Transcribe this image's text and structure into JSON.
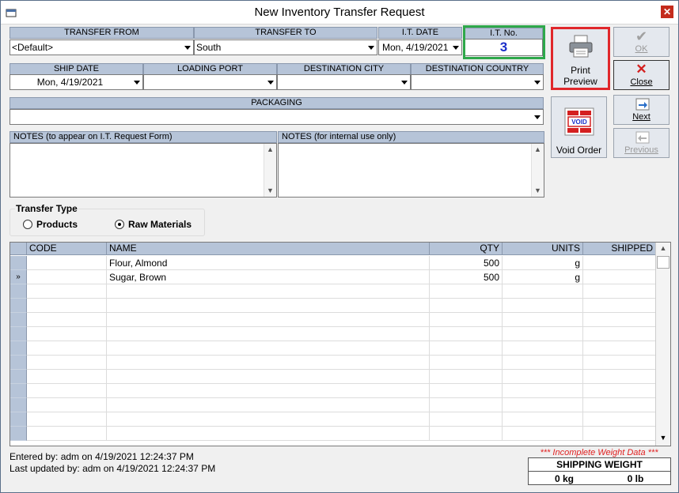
{
  "window": {
    "title": "New Inventory Transfer Request"
  },
  "row1": {
    "transfer_from": {
      "label": "TRANSFER FROM",
      "value": "<Default>"
    },
    "transfer_to": {
      "label": "TRANSFER TO",
      "value": "South"
    },
    "it_date": {
      "label": "I.T. DATE",
      "value": "Mon, 4/19/2021"
    },
    "it_no": {
      "label": "I.T. No.",
      "value": "3"
    }
  },
  "row2": {
    "ship_date": {
      "label": "SHIP DATE",
      "value": "Mon, 4/19/2021"
    },
    "loading_port": {
      "label": "LOADING PORT",
      "value": ""
    },
    "destination_city": {
      "label": "DESTINATION CITY",
      "value": ""
    },
    "destination_country": {
      "label": "DESTINATION COUNTRY",
      "value": ""
    }
  },
  "packaging": {
    "label": "PACKAGING",
    "value": ""
  },
  "notes": {
    "form_label": "NOTES (to appear on I.T. Request Form)",
    "internal_label": "NOTES (for internal use only)"
  },
  "buttons": {
    "print_preview_line1": "Print",
    "print_preview_line2": "Preview",
    "void_order": "Void Order",
    "void_stamp": "VOID",
    "ok": "OK",
    "close": "Close",
    "next": "Next",
    "previous": "Previous"
  },
  "transfer_type": {
    "title": "Transfer Type",
    "options": [
      "Products",
      "Raw Materials"
    ],
    "selected": "Raw Materials"
  },
  "grid": {
    "columns": [
      "CODE",
      "NAME",
      "QTY",
      "UNITS",
      "SHIPPED"
    ],
    "rows": [
      {
        "code": "",
        "name": "Flour, Almond",
        "qty": "500",
        "units": "g",
        "shipped": ""
      },
      {
        "code": "",
        "name": "Sugar, Brown",
        "qty": "500",
        "units": "g",
        "shipped": ""
      }
    ],
    "current_row_marker": "»"
  },
  "footer": {
    "entered_by": "Entered by: adm on 4/19/2021 12:24:37 PM",
    "last_updated": "Last updated by: adm on 4/19/2021 12:24:37 PM",
    "incomplete_warning": "*** Incomplete Weight Data ***",
    "shipping_weight_label": "SHIPPING WEIGHT",
    "weight_kg": "0 kg",
    "weight_lb": "0 lb"
  },
  "colors": {
    "header_bg": "#b6c4d8",
    "it_no_highlight": "#2ea84a",
    "print_preview_highlight": "#e0272b",
    "it_no_text": "#1a2ec9",
    "warning_text": "#e02020"
  }
}
